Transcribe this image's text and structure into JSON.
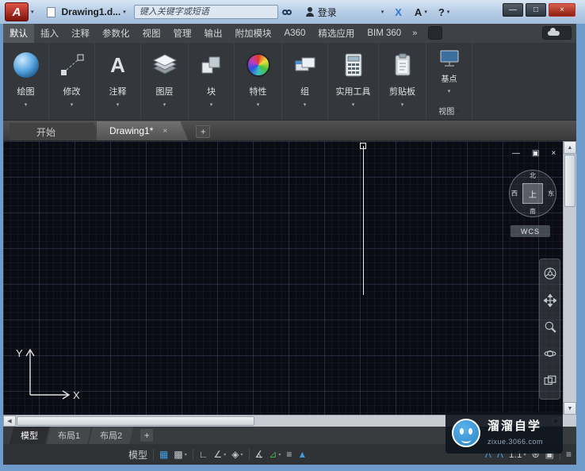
{
  "colors": {
    "frame": "#6f9bcb",
    "accent": "#3f9bdc",
    "green": "#4aa84f",
    "close_red": "#b5332a"
  },
  "glyphs": {
    "a_logo": "A",
    "caret": "▾",
    "overflow": "»",
    "minimize": "—",
    "maximize": "□",
    "restore": "▣",
    "close": "×",
    "plus": "+",
    "up": "▲",
    "down": "▼",
    "left": "◀",
    "right": "▶",
    "x_logo": "X",
    "a360_logo": "A",
    "help": "?",
    "annotate_letter": "A",
    "hamburger": "≡"
  },
  "titlebar": {
    "title": "Drawing1.d...",
    "search_placeholder": "键入关键字或短语",
    "signin": "登录"
  },
  "ribbon": {
    "tabs": [
      "默认",
      "插入",
      "注释",
      "参数化",
      "视图",
      "管理",
      "输出",
      "附加模块",
      "A360",
      "精选应用",
      "BIM 360"
    ],
    "panels": [
      "绘图",
      "修改",
      "注释",
      "图层",
      "块",
      "特性",
      "组",
      "实用工具",
      "剪贴板"
    ],
    "view_panel": {
      "button": "基点",
      "title": "视图"
    }
  },
  "file_tabs": {
    "start": "开始",
    "active": "Drawing1*"
  },
  "viewport": {
    "viewcube": {
      "n": "北",
      "s": "南",
      "w": "西",
      "e": "东",
      "top": "上"
    },
    "wcs": "WCS",
    "ucs_x": "X",
    "ucs_y": "Y"
  },
  "layout_tabs": {
    "model": "模型",
    "layout1": "布局1",
    "layout2": "布局2"
  },
  "statusbar": {
    "model": "模型",
    "scale": "1:1",
    "icons": {
      "grid": "▦",
      "snap": "▩",
      "ortho": "∟",
      "polar": "∠",
      "isodraft": "◈",
      "otrack": "∡",
      "osnap": "⊿",
      "lineweight": "≡",
      "dyn": "▲",
      "anno1": "Λ",
      "anno2": "Λ",
      "gear": "⊛",
      "monitor": "▣"
    }
  },
  "watermark": {
    "title": "溜溜自学",
    "url": "zixue.3066.com"
  }
}
